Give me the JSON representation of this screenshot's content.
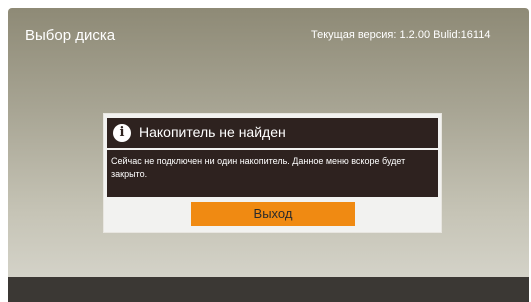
{
  "header": {
    "title": "Выбор диска",
    "version_text": "Текущая версия: 1.2.00 Bulid:16114"
  },
  "dialog": {
    "icon": "info-icon",
    "title": "Накопитель не найден",
    "message": "Сейчас не подключен ни один накопитель. Данное меню вскоре будет закрыто.",
    "exit_label": "Выход"
  },
  "colors": {
    "accent": "#f08a12",
    "dialog_dark": "#2e221f",
    "bottom_bar": "#3b3834"
  }
}
